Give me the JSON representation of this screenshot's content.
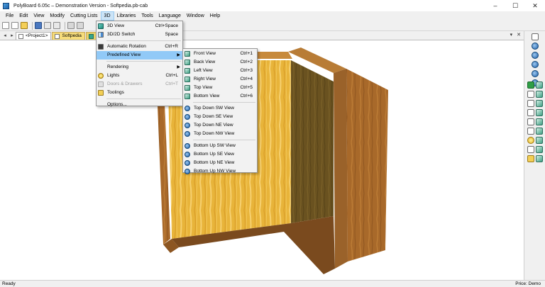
{
  "window": {
    "title": "PolyBoard 6.05c – Demonstration Version - Softpedia.pb-cab",
    "minimize": "–",
    "maximize": "☐",
    "close": "✕"
  },
  "menubar": {
    "items": [
      "File",
      "Edit",
      "View",
      "Modify",
      "Cutting Lists",
      "3D",
      "Libraries",
      "Tools",
      "Language",
      "Window",
      "Help"
    ],
    "active": "3D"
  },
  "tabs": {
    "items": [
      {
        "label": "<Project1>"
      },
      {
        "label": "Softpedia"
      },
      {
        "label": "S"
      }
    ],
    "right_controls": [
      "▾",
      "✕"
    ]
  },
  "menu_3d": {
    "items": [
      {
        "label": "3D View",
        "shortcut": "Ctrl+Space",
        "icon": "view-3d-icon"
      },
      {
        "label": "3D/2D Switch",
        "shortcut": "Space",
        "icon": "switch-2d-3d-icon"
      },
      {
        "label": "Automatic Rotation",
        "shortcut": "Ctrl+R",
        "icon": "rotation-icon"
      },
      {
        "label": "Predefined View",
        "shortcut": "",
        "icon": "",
        "submenu": true
      },
      {
        "label": "Rendering",
        "shortcut": "",
        "icon": "",
        "submenu": true
      },
      {
        "label": "Lights",
        "shortcut": "Ctrl+L",
        "icon": "bulb-icon"
      },
      {
        "label": "Doors & Drawers",
        "shortcut": "Ctrl+T",
        "icon": "doors-drawers-icon",
        "disabled": true
      },
      {
        "label": "Toolings",
        "shortcut": "",
        "icon": "toolings-icon"
      },
      {
        "label": "Options...",
        "shortcut": "",
        "icon": ""
      }
    ]
  },
  "menu_predefined": {
    "items": [
      {
        "label": "Front View",
        "shortcut": "Ctrl+1"
      },
      {
        "label": "Back View",
        "shortcut": "Ctrl+2"
      },
      {
        "label": "Left View",
        "shortcut": "Ctrl+3"
      },
      {
        "label": "Right View",
        "shortcut": "Ctrl+4"
      },
      {
        "label": "Top View",
        "shortcut": "Ctrl+5"
      },
      {
        "label": "Bottom View",
        "shortcut": "Ctrl+6"
      },
      {
        "label": "Top Down SW View",
        "shortcut": ""
      },
      {
        "label": "Top Down SE View",
        "shortcut": ""
      },
      {
        "label": "Top Down NE View",
        "shortcut": ""
      },
      {
        "label": "Top Down NW View",
        "shortcut": ""
      },
      {
        "label": "Bottom Up SW View",
        "shortcut": ""
      },
      {
        "label": "Bottom Up SE View",
        "shortcut": ""
      },
      {
        "label": "Bottom Up NE View",
        "shortcut": ""
      },
      {
        "label": "Bottom Up NW View",
        "shortcut": ""
      }
    ]
  },
  "status": {
    "left": "Ready",
    "right": "Price: Demo"
  },
  "colors": {
    "wood_light": "#e9b63c",
    "wood_dark": "#8a5a22",
    "inner_shadow": "#5e4a1c",
    "menu_highlight": "#91c9f7"
  }
}
